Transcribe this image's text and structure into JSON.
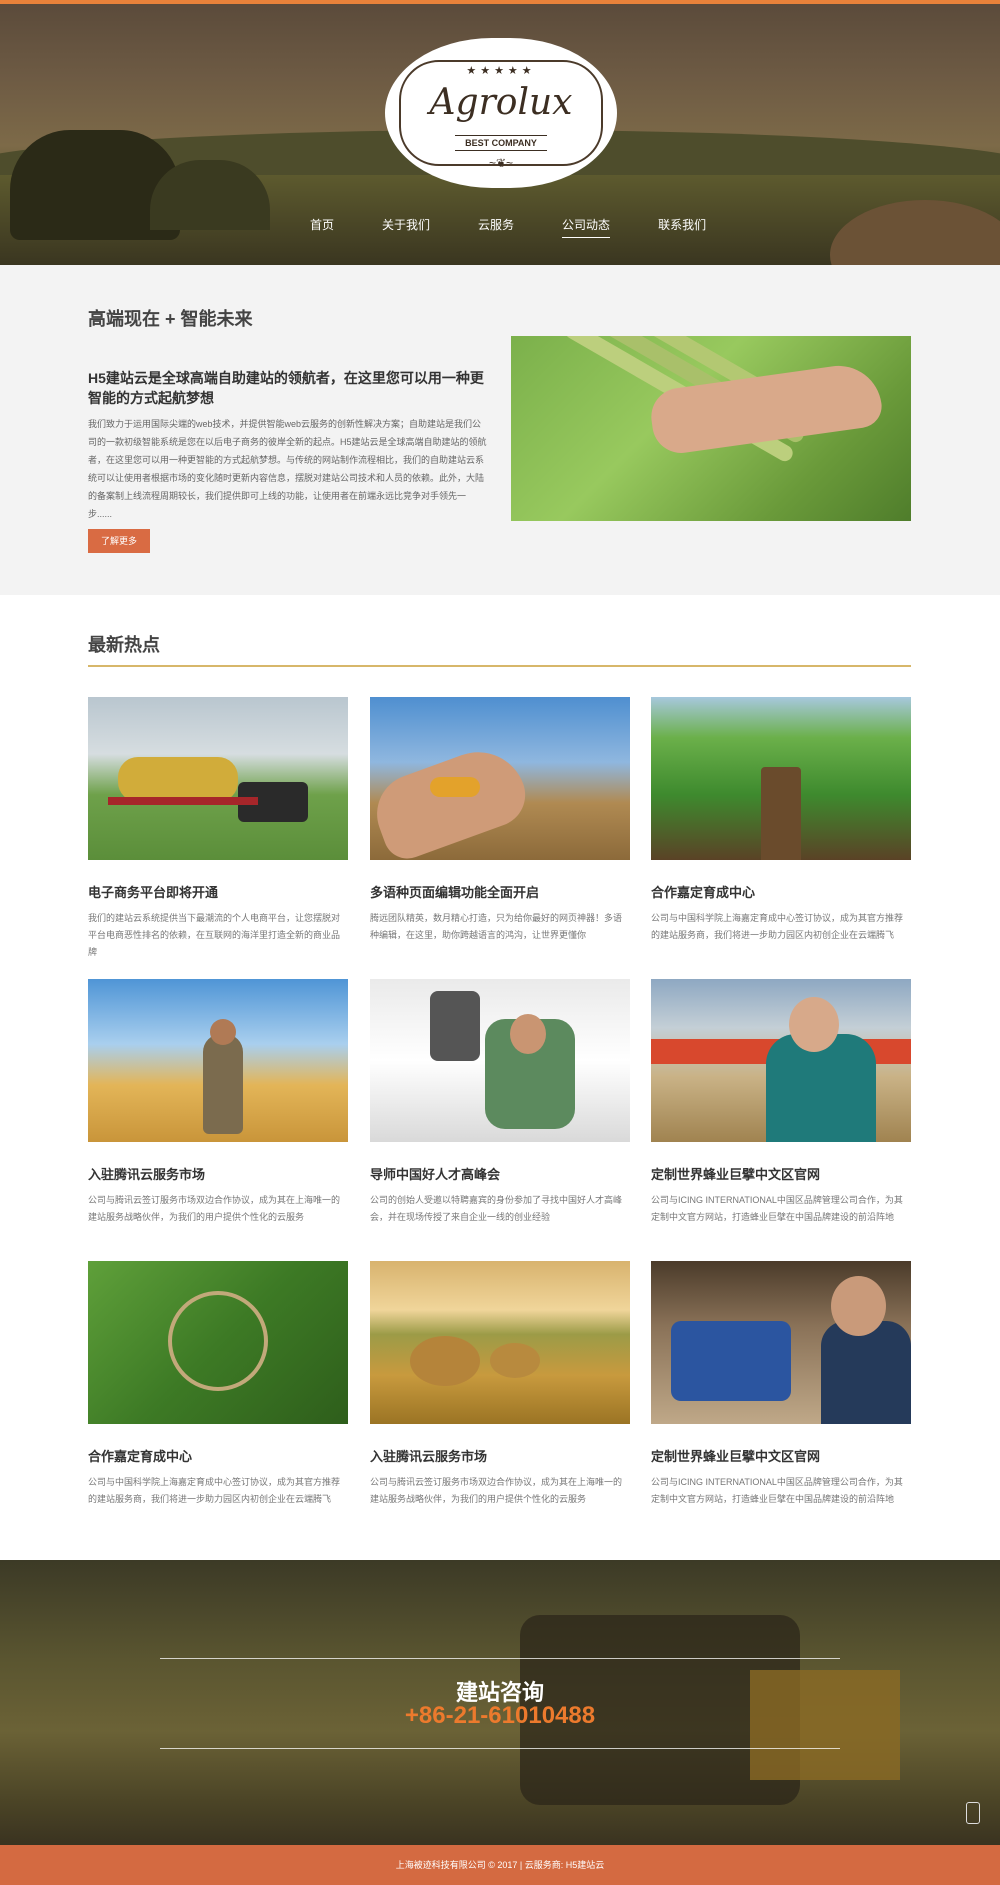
{
  "header": {
    "logo": {
      "stars": "★★★★★",
      "name": "Agrolux",
      "tagline": "BEST COMPANY",
      "flourish": "~❦~"
    },
    "nav": [
      "首页",
      "关于我们",
      "云服务",
      "公司动态",
      "联系我们"
    ],
    "active_nav": "公司动态",
    "accent_color": "#e8823a"
  },
  "about": {
    "title": "高端现在 + 智能未来",
    "subtitle": "H5建站云是全球高端自助建站的领航者，在这里您可以用一种更智能的方式起航梦想",
    "body": "我们致力于运用国际尖端的web技术，并提供智能web云服务的创新性解决方案；自助建站是我们公司的一款初级智能系统是您在以后电子商务的彼岸全新的起点。H5建站云是全球高端自助建站的领航者，在这里您可以用一种更智能的方式起航梦想。与传统的网站制作流程相比，我们的自助建站云系统可以让使用者根据市场的变化随时更新内容信息，摆脱对建站公司技术和人员的依赖。此外，大陆的备案制上线流程周期较长，我们提供即可上线的功能，让使用者在前端永远比竞争对手领先一步......",
    "button": "了解更多"
  },
  "news": {
    "title": "最新热点",
    "items": [
      {
        "title": "电子商务平台即将开通",
        "desc": "我们的建站云系统提供当下最潮流的个人电商平台，让您摆脱对平台电商恶性排名的依赖，在互联网的海洋里打造全新的商业品牌",
        "icon": "tractor-hay-photo"
      },
      {
        "title": "多语种页面编辑功能全面开启",
        "desc": "腾远团队精英，数月精心打造，只为给你最好的网页神器！多语种编辑，在这里，助你跨越语言的鸿沟，让世界更懂你",
        "icon": "corn-hand-photo"
      },
      {
        "title": "合作嘉定育成中心",
        "desc": "公司与中国科学院上海嘉定育成中心签订协议，成为其官方推荐的建站服务商，我们将进一步助力园区内初创企业在云端腾飞",
        "icon": "corn-field-photo"
      },
      {
        "title": "入驻腾讯云服务市场",
        "desc": "公司与腾讯云签订服务市场双边合作协议，成为其在上海唯一的建站服务战略伙伴，为我们的用户提供个性化的云服务",
        "icon": "farmer-wheat-photo"
      },
      {
        "title": "导师中国好人才高峰会",
        "desc": "公司的创始人受邀以特聘嘉宾的身份参加了寻找中国好人才高峰会，并在现场传授了来自企业一线的创业经验",
        "icon": "truck-driver-photo"
      },
      {
        "title": "定制世界蜂业巨擘中文区官网",
        "desc": "公司与ICING INTERNATIONAL中国区品牌管理公司合作，为其定制中文官方网站，打造蜂业巨擘在中国品牌建设的前沿阵地",
        "icon": "old-farmer-photo"
      },
      {
        "title": "合作嘉定育成中心",
        "desc": "公司与中国科学院上海嘉定育成中心签订协议，成为其官方推荐的建站服务商，我们将进一步助力园区内初创企业在云端腾飞",
        "icon": "green-beans-photo"
      },
      {
        "title": "入驻腾讯云服务市场",
        "desc": "公司与腾讯云签订服务市场双边合作协议，成为其在上海唯一的建站服务战略伙伴，为我们的用户提供个性化的云服务",
        "icon": "hay-bales-photo"
      },
      {
        "title": "定制世界蜂业巨擘中文区官网",
        "desc": "公司与ICING INTERNATIONAL中国区品牌管理公司合作，为其定制中文官方网站，打造蜂业巨擘在中国品牌建设的前沿阵地",
        "icon": "man-tractor-photo"
      }
    ]
  },
  "cta": {
    "heading": "建站咨询",
    "phone": "+86-21-61010488",
    "phone_color": "#ec7a2d"
  },
  "footer": {
    "text": "上海被迹科技有限公司 © 2017 | 云服务商: H5建站云",
    "color": "#d46a41"
  }
}
